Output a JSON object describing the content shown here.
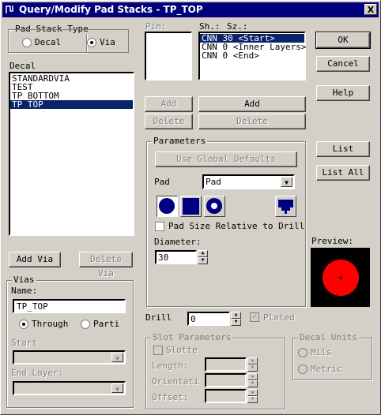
{
  "window": {
    "title": "Query/Modify Pad Stacks - TP_TOP",
    "close_glyph": "X"
  },
  "pad_stack_type": {
    "label": "Pad Stack Type",
    "options": [
      {
        "label": "Decal",
        "selected": false
      },
      {
        "label": "Via",
        "selected": true
      }
    ]
  },
  "decal": {
    "label": "Decal",
    "items": [
      {
        "text": "STANDARDVIA",
        "selected": false
      },
      {
        "text": "TEST",
        "selected": false
      },
      {
        "text": "TP_BOTTOM",
        "selected": false
      },
      {
        "text": "TP_TOP",
        "selected": true
      }
    ],
    "add_via": "Add Via",
    "delete_via": "Delete Via"
  },
  "vias": {
    "label": "Vias",
    "name_label": "Name:",
    "name_value": "TP_TOP",
    "through_label": "Through",
    "partial_label": "Parti",
    "through_selected": true,
    "start_label": "Start",
    "end_layer_label": "End Layer:"
  },
  "pin": {
    "label": "Pin:",
    "add": "Add",
    "delete": "Delete"
  },
  "sh": {
    "label_sh": "Sh.:",
    "label_sz": "Sz.:",
    "items": [
      {
        "text": "CNN 30 <Start>",
        "selected": true
      },
      {
        "text": "CNN 0 <Inner Layers>",
        "selected": false
      },
      {
        "text": "CNN 0 <End>",
        "selected": false
      }
    ],
    "add": "Add",
    "delete": "Delete"
  },
  "buttons": {
    "ok": "OK",
    "cancel": "Cancel",
    "help": "Help",
    "list": "List",
    "list_all": "List All"
  },
  "parameters": {
    "label": "Parameters",
    "use_global": "Use Global Defaults",
    "pad_label": "Pad",
    "pad_value": "Pad",
    "pad_size_relative": "Pad Size Relative to Drill",
    "diameter_label": "Diameter:",
    "diameter_value": "30",
    "shape_color": "#000080"
  },
  "preview": {
    "label": "Preview:",
    "bg": "#000000",
    "pad_color": "#ff0000"
  },
  "drill": {
    "label": "Drill",
    "value": "0",
    "plated_label": "Plated",
    "plated_checked": true
  },
  "slot": {
    "label": "Slot Parameters",
    "slotted_label": "Slotte",
    "length_label": "Length:",
    "orientation_label": "Orientati",
    "offset_label": "Offset:"
  },
  "decal_units": {
    "label": "Decal Units",
    "mils": "Mils",
    "metric": "Metric"
  }
}
